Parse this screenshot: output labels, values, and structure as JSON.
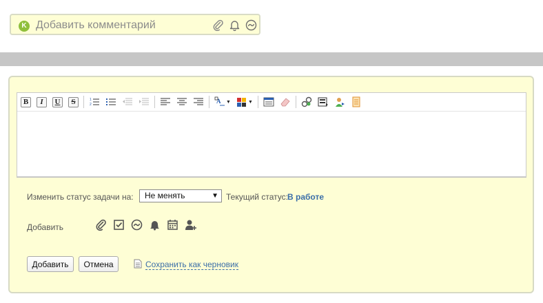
{
  "comment_bar": {
    "avatar_letter": "K",
    "placeholder": "Добавить комментарий",
    "icons": [
      "paperclip-icon",
      "bell-icon",
      "tilde-circle-icon"
    ]
  },
  "toolbar": {
    "bold": "B",
    "italic": "I",
    "underline": "U",
    "strike": "S"
  },
  "status": {
    "label": "Изменить статус задачи на:",
    "selected": "Не менять",
    "current_label": "Текущий статус:",
    "current_value": "В работе"
  },
  "add_section": {
    "label": "Добавить",
    "icons": [
      "paperclip-icon",
      "checkbox-icon",
      "tilde-circle-icon",
      "bell-icon",
      "calendar-icon",
      "add-user-icon"
    ]
  },
  "actions": {
    "add_label": "Добавить",
    "cancel_label": "Отмена",
    "draft_label": "Сохранить как черновик"
  },
  "colors": {
    "panel_bg": "#fefed5",
    "link": "#3b6ea8",
    "avatar": "#8fbf3c"
  }
}
